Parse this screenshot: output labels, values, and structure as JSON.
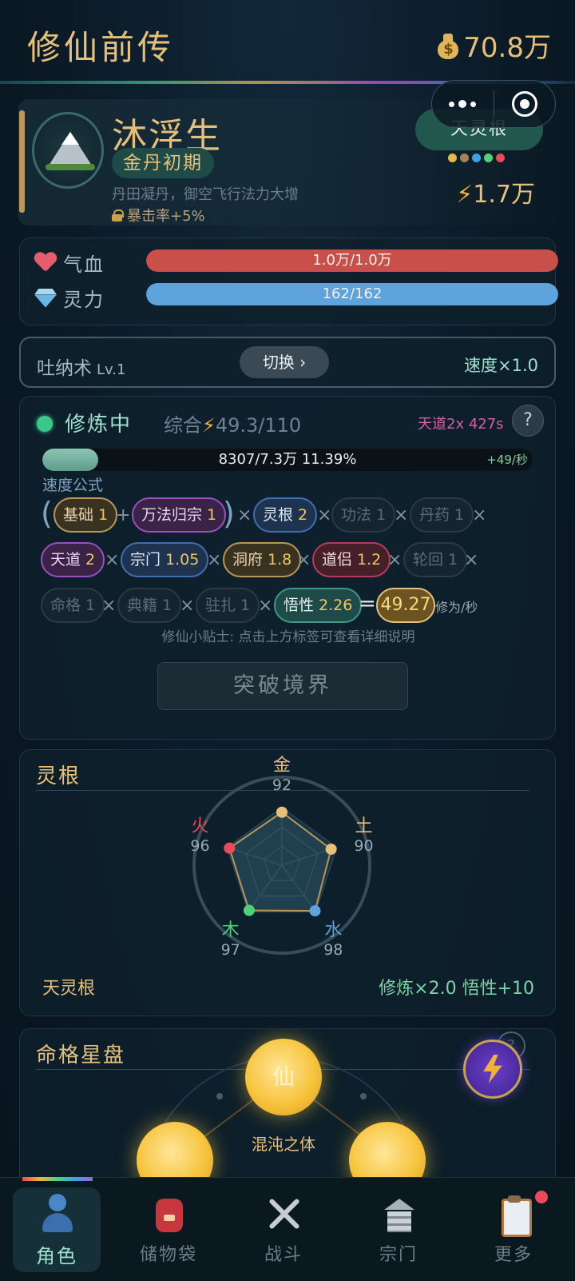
{
  "header": {
    "title": "修仙前传",
    "gold": "70.8万"
  },
  "capsule": {
    "more_icon": "dots-icon",
    "close_icon": "target-icon"
  },
  "profile": {
    "name": "沐浮生",
    "realm": "金丹初期",
    "description": "丹田凝丹，御空飞行法力大增",
    "crit_bonus": "暴击率+5%",
    "root_badge": "天灵根",
    "element_dot_colors": [
      "#e6b84a",
      "#a0845a",
      "#3aa3e6",
      "#4fd17a",
      "#e84b5a"
    ],
    "power": "1.7万"
  },
  "vitals": {
    "hp": {
      "label": "气血",
      "text": "1.0万/1.0万",
      "fraction": 1.0,
      "color": "#c9504a"
    },
    "mp": {
      "label": "灵力",
      "text": "162/162",
      "fraction": 1.0,
      "color": "#5fa3dc"
    }
  },
  "technique": {
    "name": "吐纳术",
    "level": "Lv.1",
    "switch_label": "切换 ›",
    "speed": "速度×1.0"
  },
  "cultivation": {
    "status": "修炼中",
    "overall_label": "综合",
    "overall_value": "49.3/110",
    "dao_timer": "天道2x 427s",
    "help": "?",
    "progress_text": "8307/7.3万  11.39%",
    "progress_fraction": 0.1139,
    "rate": "+49/秒",
    "formula_label": "速度公式",
    "factors": [
      {
        "name": "基础",
        "value": "1"
      },
      {
        "name": "万法归宗",
        "value": "1"
      },
      {
        "name": "灵根",
        "value": "2"
      },
      {
        "name": "功法",
        "value": "1"
      },
      {
        "name": "丹药",
        "value": "1"
      },
      {
        "name": "天道",
        "value": "2"
      },
      {
        "name": "宗门",
        "value": "1.05"
      },
      {
        "name": "洞府",
        "value": "1.8"
      },
      {
        "name": "道侣",
        "value": "1.2"
      },
      {
        "name": "轮回",
        "value": "1"
      },
      {
        "name": "命格",
        "value": "1"
      },
      {
        "name": "典籍",
        "value": "1"
      },
      {
        "name": "驻扎",
        "value": "1"
      },
      {
        "name": "悟性",
        "value": "2.26"
      }
    ],
    "ops": {
      "plus": "+",
      "times": "×",
      "equals": "=",
      "lparen": "(",
      "rparen": ")"
    },
    "total": "49.27",
    "unit": "修为/秒",
    "tip": "修仙小贴士: 点击上方标签可查看详细说明",
    "breakthrough_label": "突破境界"
  },
  "spirit_root": {
    "title": "灵根",
    "elements": [
      {
        "name": "金",
        "value": "92",
        "color": "#e6c07a"
      },
      {
        "name": "土",
        "value": "90",
        "color": "#e6c07a"
      },
      {
        "name": "水",
        "value": "98",
        "color": "#5fa3dc"
      },
      {
        "name": "木",
        "value": "97",
        "color": "#4fd17a"
      },
      {
        "name": "火",
        "value": "96",
        "color": "#e84b5a"
      }
    ],
    "root_name": "天灵根",
    "bonus": "修炼×2.0  悟性+10"
  },
  "star_chart": {
    "title": "命格星盘",
    "main_orb": "仙",
    "constitution": "混沌之体",
    "help": "?"
  },
  "tabs": [
    {
      "label": "角色",
      "icon": "person-icon"
    },
    {
      "label": "储物袋",
      "icon": "backpack-icon"
    },
    {
      "label": "战斗",
      "icon": "swords-icon"
    },
    {
      "label": "宗门",
      "icon": "temple-icon"
    },
    {
      "label": "更多",
      "icon": "clipboard-icon"
    }
  ]
}
